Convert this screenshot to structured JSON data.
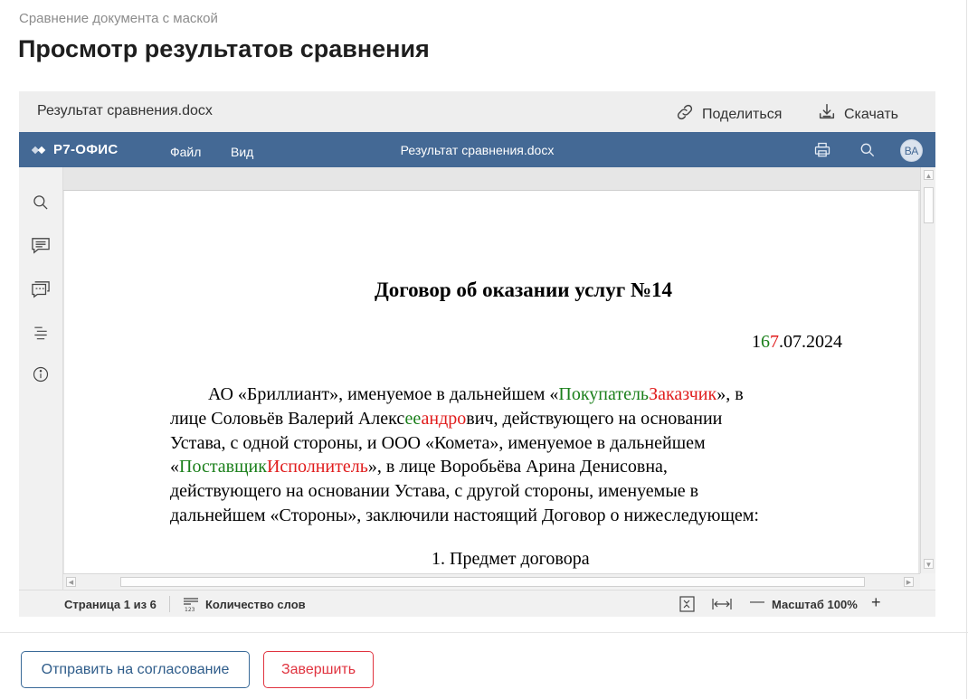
{
  "breadcrumb": "Сравнение документа с маской",
  "page_title": "Просмотр результатов сравнения",
  "file_bar": {
    "file_name": "Результат сравнения.docx",
    "share_label": "Поделиться",
    "download_label": "Скачать"
  },
  "app_header": {
    "logo_text": "Р7-ОФИС",
    "menu_file": "Файл",
    "menu_view": "Вид",
    "doc_title": "Результат сравнения.docx",
    "avatar_initials": "ВА"
  },
  "document": {
    "heading": "Договор об оказании услуг №14",
    "date": {
      "p1": "1",
      "ins": "6",
      "del": "7",
      "p2": ".07.2024"
    },
    "para": {
      "l1_a": "АО «Бриллиант», именуемое в дальнейшем «",
      "l1_ins": "Покупатель",
      "l1_del": "Заказчик",
      "l1_b": "», в",
      "l2_a": "лице Соловьёв Валерий Алекс",
      "l2_ins": "ее",
      "l2_del": "андро",
      "l2_b": "вич, действующего на основании",
      "l3": "Устава, с одной стороны, и ООО «Комета», именуемое в дальнейшем",
      "l4_a": "«",
      "l4_ins": "Поставщик",
      "l4_del": "Исполнитель",
      "l4_b": "», в лице Воробьёва Арина Денисовна,",
      "l5": "действующего на основании Устава, с другой стороны, именуемые в",
      "l6": "дальнейшем «Стороны», заключили настоящий Договор о нижеследующем:"
    },
    "section_heading": "1. Предмет договора"
  },
  "status_bar": {
    "page_counter": "Страница 1 из 6",
    "word_count": "Количество слов",
    "zoom_level": "Масштаб 100%",
    "zoom_out": "—",
    "zoom_in": "+"
  },
  "buttons": {
    "approve": "Отправить на согласование",
    "finish": "Завершить"
  },
  "colors": {
    "header": "#446995",
    "inserted": "#1a7f1a",
    "deleted": "#e01b1b",
    "primary_button": "#3a6a98",
    "danger_button": "#e0333f"
  },
  "icons": [
    "link-icon",
    "download-icon",
    "print-icon",
    "search-icon",
    "comment-icon",
    "chat-icon",
    "navigation-icon",
    "info-icon",
    "word-count-icon",
    "fit-page-icon",
    "fit-width-icon"
  ]
}
